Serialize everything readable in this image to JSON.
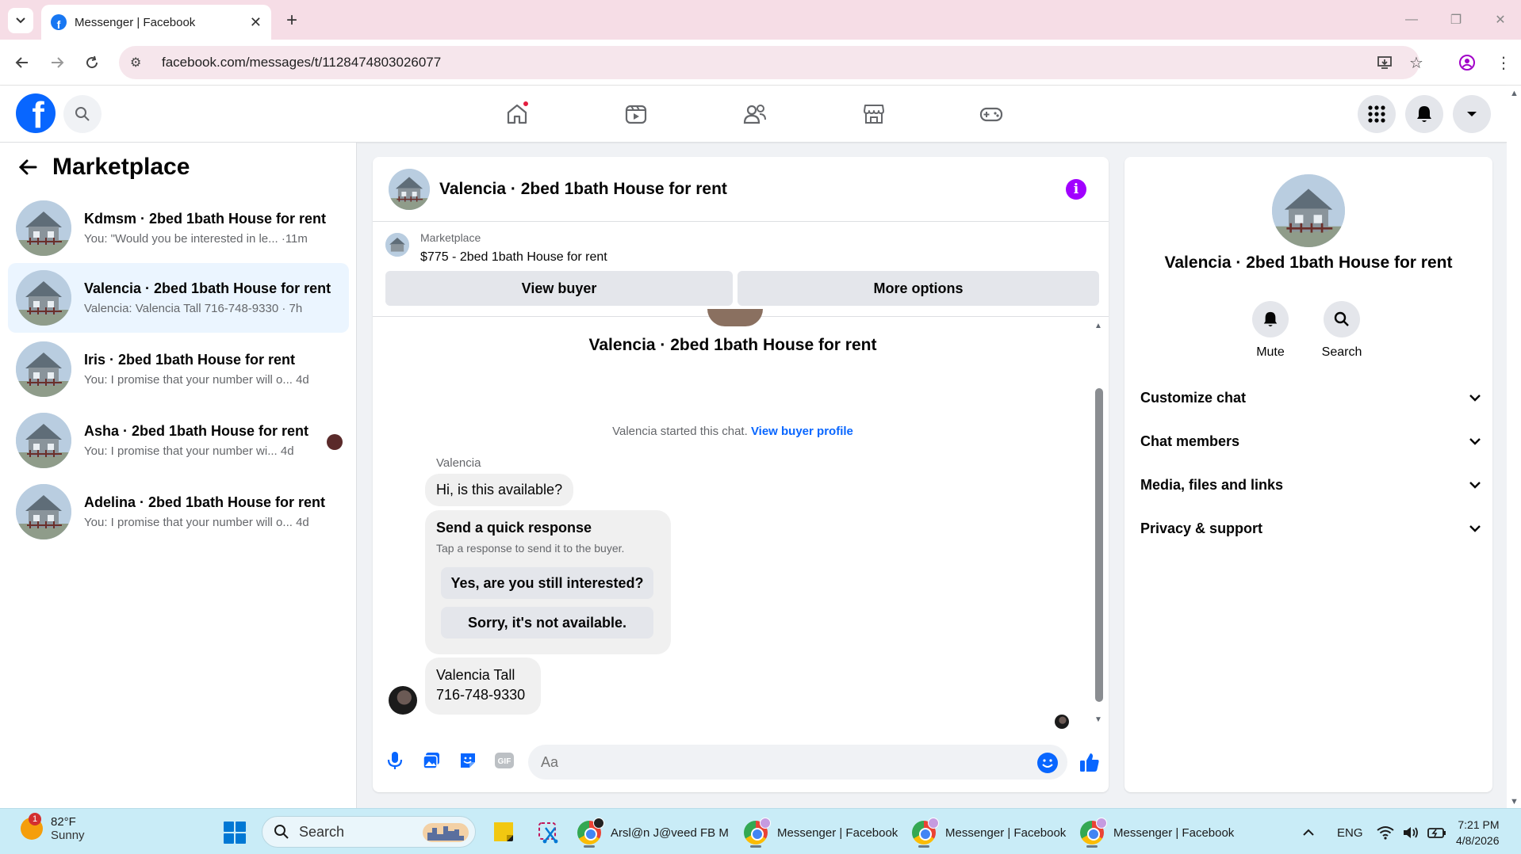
{
  "browser": {
    "tab_title": "Messenger | Facebook",
    "url": "facebook.com/messages/t/1128474803026077"
  },
  "fb_nav": {
    "logo_letter": "f"
  },
  "left_panel": {
    "title": "Marketplace",
    "conversations": [
      {
        "title": "Kdmsm · 2bed 1bath House for rent",
        "preview": "You: \"Would you be interested in le... ·11m"
      },
      {
        "title": "Valencia · 2bed 1bath House for rent",
        "preview": "Valencia: Valencia Tall 716-748-9330 · 7h"
      },
      {
        "title": "Iris · 2bed 1bath House for rent",
        "preview": "You: I promise that your number will o... 4d"
      },
      {
        "title": "Asha · 2bed 1bath House for rent",
        "preview": "You: I promise that your number wi... 4d"
      },
      {
        "title": "Adelina · 2bed 1bath House for rent",
        "preview": "You: I promise that your number will o... 4d"
      }
    ]
  },
  "chat": {
    "header_title": "Valencia · 2bed 1bath House for rent",
    "info_glyph": "i",
    "marketplace_label": "Marketplace",
    "listing": "$775 - 2bed 1bath House for rent",
    "view_buyer": "View buyer",
    "more_options": "More options",
    "thread_title": "Valencia · 2bed 1bath House for rent",
    "started_text": "Valencia started this chat. ",
    "view_buyer_profile": "View buyer profile",
    "sender": "Valencia",
    "msg1": "Hi, is this available?",
    "quick_response_title": "Send a quick response",
    "quick_response_sub": "Tap a response to send it to the buyer.",
    "quick_reply_1": "Yes, are you still interested?",
    "quick_reply_2": "Sorry, it's not available.",
    "msg2_line1": "Valencia Tall",
    "msg2_line2": "716-748-9330",
    "composer_placeholder": "Aa",
    "gif_label": "GIF"
  },
  "info_panel": {
    "title": "Valencia · 2bed 1bath House for rent",
    "mute": "Mute",
    "search": "Search",
    "rows": [
      "Customize chat",
      "Chat members",
      "Media, files and links",
      "Privacy & support"
    ]
  },
  "taskbar": {
    "weather_temp": "82°F",
    "weather_cond": "Sunny",
    "weather_badge": "1",
    "search_label": "Search",
    "chrome_windows": [
      "Arsl@n J@veed FB M",
      "Messenger | Facebook",
      "Messenger | Facebook",
      "Messenger | Facebook"
    ],
    "lang": "ENG",
    "time": "7:21 PM",
    "date": "4/8/2026"
  },
  "colors": {
    "fb_blue": "#0866ff",
    "accent_purple": "#a100ff",
    "active_row": "#ebf5ff"
  }
}
